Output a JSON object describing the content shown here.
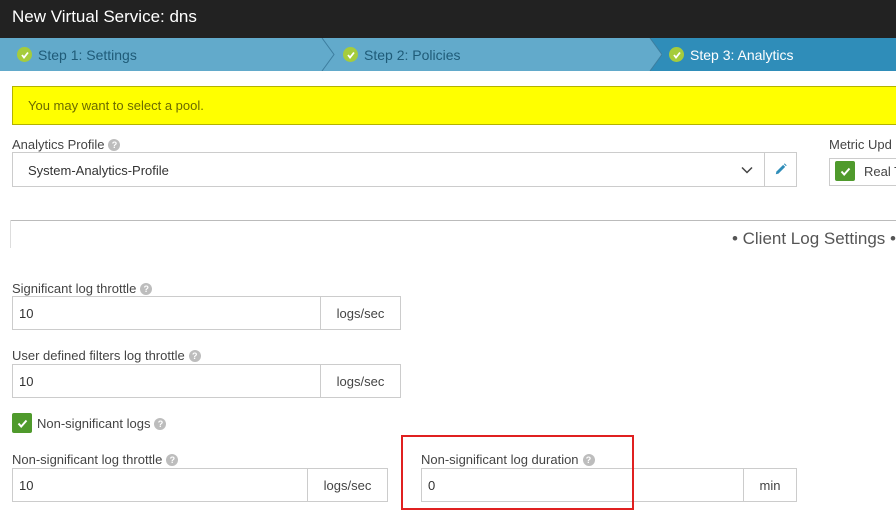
{
  "window": {
    "title": "New Virtual Service: dns"
  },
  "wizard": {
    "steps": [
      {
        "label": "Step 1: Settings",
        "state": "completed"
      },
      {
        "label": "Step 2: Policies",
        "state": "completed"
      },
      {
        "label": "Step 3: Analytics",
        "state": "active"
      }
    ]
  },
  "alert": {
    "message": "You may want to select a pool."
  },
  "analytics_profile": {
    "label": "Analytics Profile",
    "value": "System-Analytics-Profile"
  },
  "metric_update": {
    "label": "Metric Upd",
    "checkbox_label": "Real T"
  },
  "section": {
    "title": "• Client Log Settings •"
  },
  "fields": {
    "significant_throttle": {
      "label": "Significant log throttle",
      "value": "10",
      "unit": "logs/sec"
    },
    "user_filters_throttle": {
      "label": "User defined filters log throttle",
      "value": "10",
      "unit": "logs/sec"
    },
    "non_significant_logs": {
      "label": "Non-significant logs",
      "checked": true
    },
    "non_significant_throttle": {
      "label": "Non-significant log throttle",
      "value": "10",
      "unit": "logs/sec"
    },
    "non_significant_duration": {
      "label": "Non-significant log duration",
      "value": "0",
      "unit": "min"
    }
  },
  "colors": {
    "titlebar": "#222222",
    "wizard": "#62aacb",
    "wizard_active": "#2f8db9",
    "check": "#a5cc3c",
    "alert": "#ffff00",
    "checkbox": "#4f9a2c",
    "highlight": "#e02020"
  },
  "icons": {
    "step_check": "check-circle-icon",
    "help": "question-circle-icon",
    "dropdown": "chevron-down-icon",
    "edit": "pencil-icon",
    "checkbox": "checkmark-icon"
  }
}
